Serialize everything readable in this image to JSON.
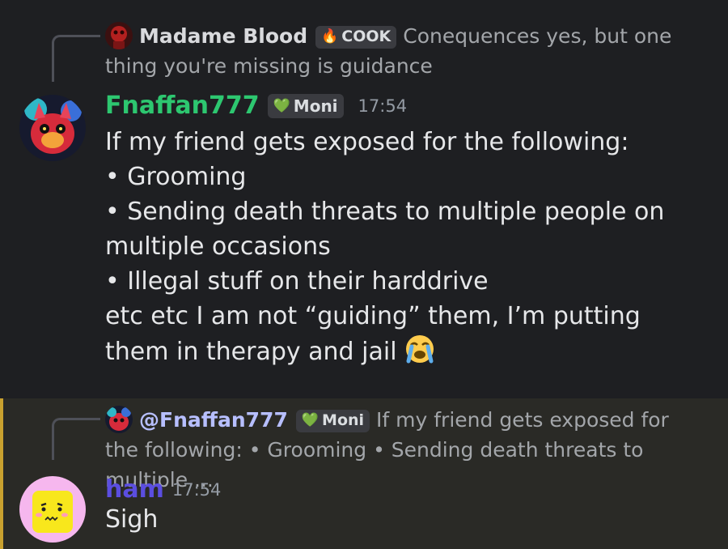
{
  "messages": [
    {
      "reply": {
        "name": "Madame Blood",
        "tag_label": "COOK",
        "tag_icon": "fire-icon",
        "text": "Conequences yes, but one thing you're missing is guidance"
      },
      "author": {
        "name": "Fnaffan777",
        "name_color": "#2dc770",
        "tag_label": "Moni",
        "tag_icon": "heart-icon",
        "timestamp": "17:54"
      },
      "lines": [
        "If my friend gets exposed for the following:",
        "• Grooming",
        "• Sending death threats to multiple people on multiple occasions",
        "• Illegal stuff on their harddrive",
        "etc etc I am not “guiding” them, I’m putting them in therapy and jail"
      ],
      "emoji": "loudly-crying-face-emoji"
    },
    {
      "reply": {
        "name": "@Fnaffan777",
        "tag_label": "Moni",
        "tag_icon": "heart-icon",
        "text": "If my friend gets exposed for the following: • Grooming • Sending death threats to multiple ..."
      },
      "author": {
        "name": "ham",
        "name_color": "#5b4ee0",
        "timestamp": "17:54"
      },
      "lines": [
        "Sigh"
      ],
      "highlight_color": "#c9a12f"
    }
  ]
}
